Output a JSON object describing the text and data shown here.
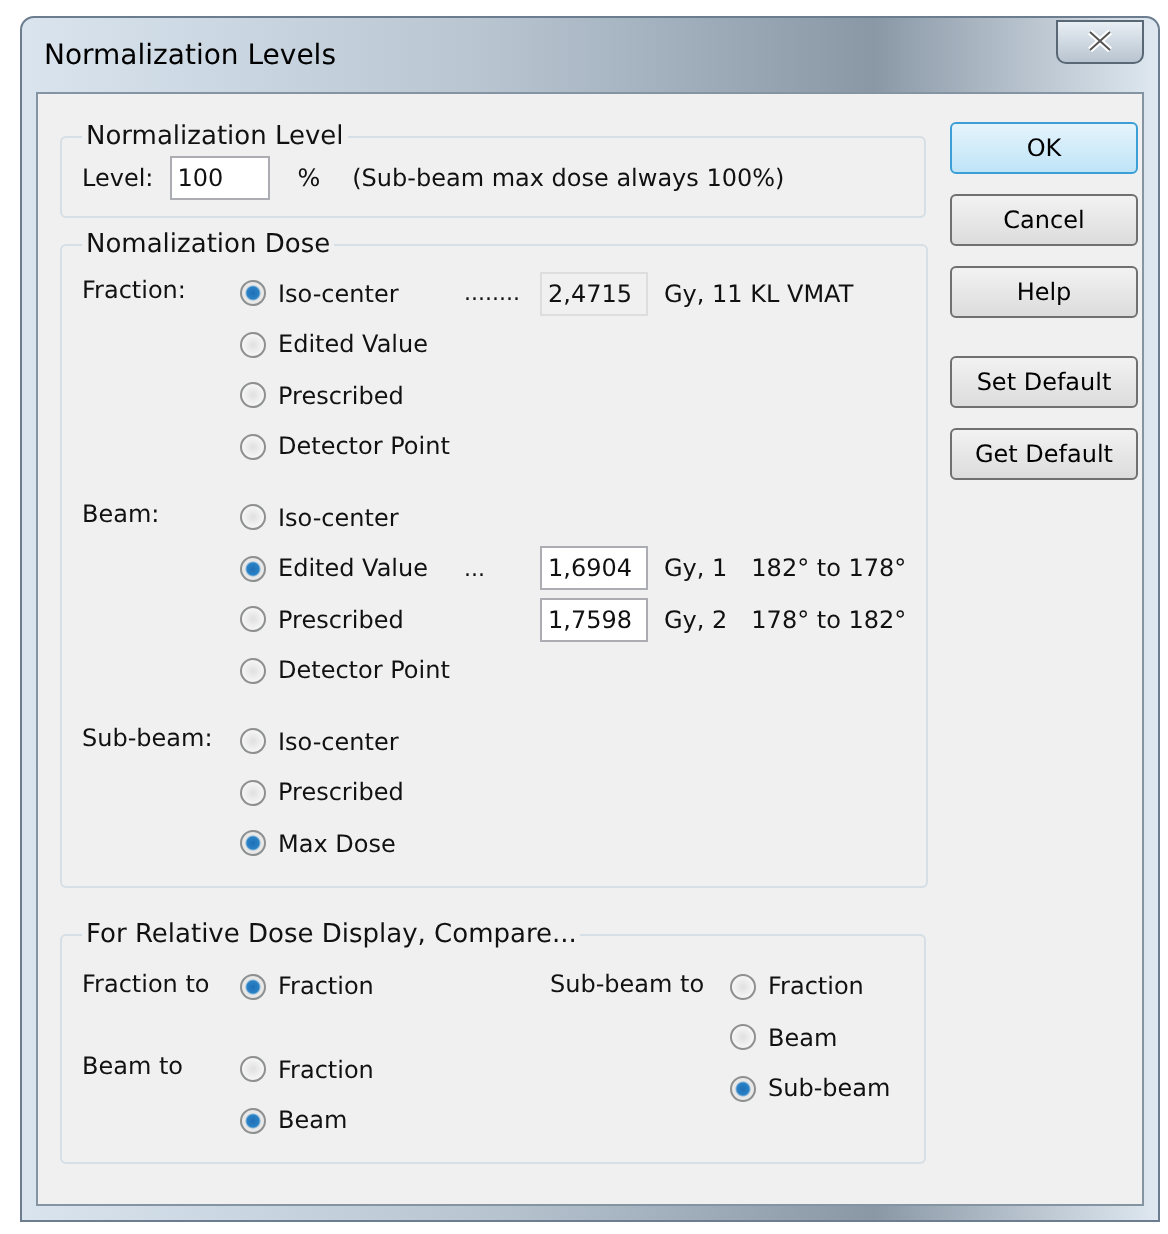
{
  "window": {
    "title": "Normalization Levels"
  },
  "level_group": {
    "title": "Normalization Level",
    "label": "Level:",
    "value": "100",
    "unit": "%",
    "note": "(Sub-beam max dose always 100%)"
  },
  "dose_group": {
    "title": "Nomalization Dose",
    "sections": [
      {
        "label": "Fraction:",
        "options": [
          {
            "label": "Iso-center",
            "selected": true,
            "leader": "........",
            "field": {
              "value": "2,4715",
              "readonly": true
            },
            "unit": "Gy, 11 KL VMAT"
          },
          {
            "label": "Edited Value",
            "selected": false
          },
          {
            "label": "Prescribed",
            "selected": false
          },
          {
            "label": "Detector Point",
            "selected": false
          }
        ]
      },
      {
        "label": "Beam:",
        "options": [
          {
            "label": "Iso-center",
            "selected": false
          },
          {
            "label": "Edited Value",
            "selected": true,
            "leader": "...",
            "field": {
              "value": "1,6904",
              "readonly": false
            },
            "unit": "Gy, 1",
            "range": "182° to 178°"
          },
          {
            "label": "Prescribed",
            "selected": false,
            "field": {
              "value": "1,7598",
              "readonly": false
            },
            "unit": "Gy, 2",
            "range": "178° to 182°"
          },
          {
            "label": "Detector Point",
            "selected": false
          }
        ]
      },
      {
        "label": "Sub-beam:",
        "options": [
          {
            "label": "Iso-center",
            "selected": false
          },
          {
            "label": "Prescribed",
            "selected": false
          },
          {
            "label": "Max Dose",
            "selected": true
          }
        ]
      }
    ]
  },
  "compare_group": {
    "title": "For Relative Dose Display, Compare...",
    "columns": [
      [
        {
          "label": "Fraction to",
          "options": [
            {
              "label": "Fraction",
              "selected": true
            }
          ]
        },
        {
          "label": "Beam to",
          "options": [
            {
              "label": "Fraction",
              "selected": false
            },
            {
              "label": "Beam",
              "selected": true
            }
          ]
        }
      ],
      [
        {
          "label": "Sub-beam to",
          "options": [
            {
              "label": "Fraction",
              "selected": false
            },
            {
              "label": "Beam",
              "selected": false
            },
            {
              "label": "Sub-beam",
              "selected": true
            }
          ]
        }
      ]
    ]
  },
  "buttons": [
    [
      {
        "label": "OK",
        "default": true
      },
      {
        "label": "Cancel",
        "default": false
      },
      {
        "label": "Help",
        "default": false
      }
    ],
    [
      {
        "label": "Set Default",
        "default": false
      },
      {
        "label": "Get Default",
        "default": false
      }
    ]
  ]
}
